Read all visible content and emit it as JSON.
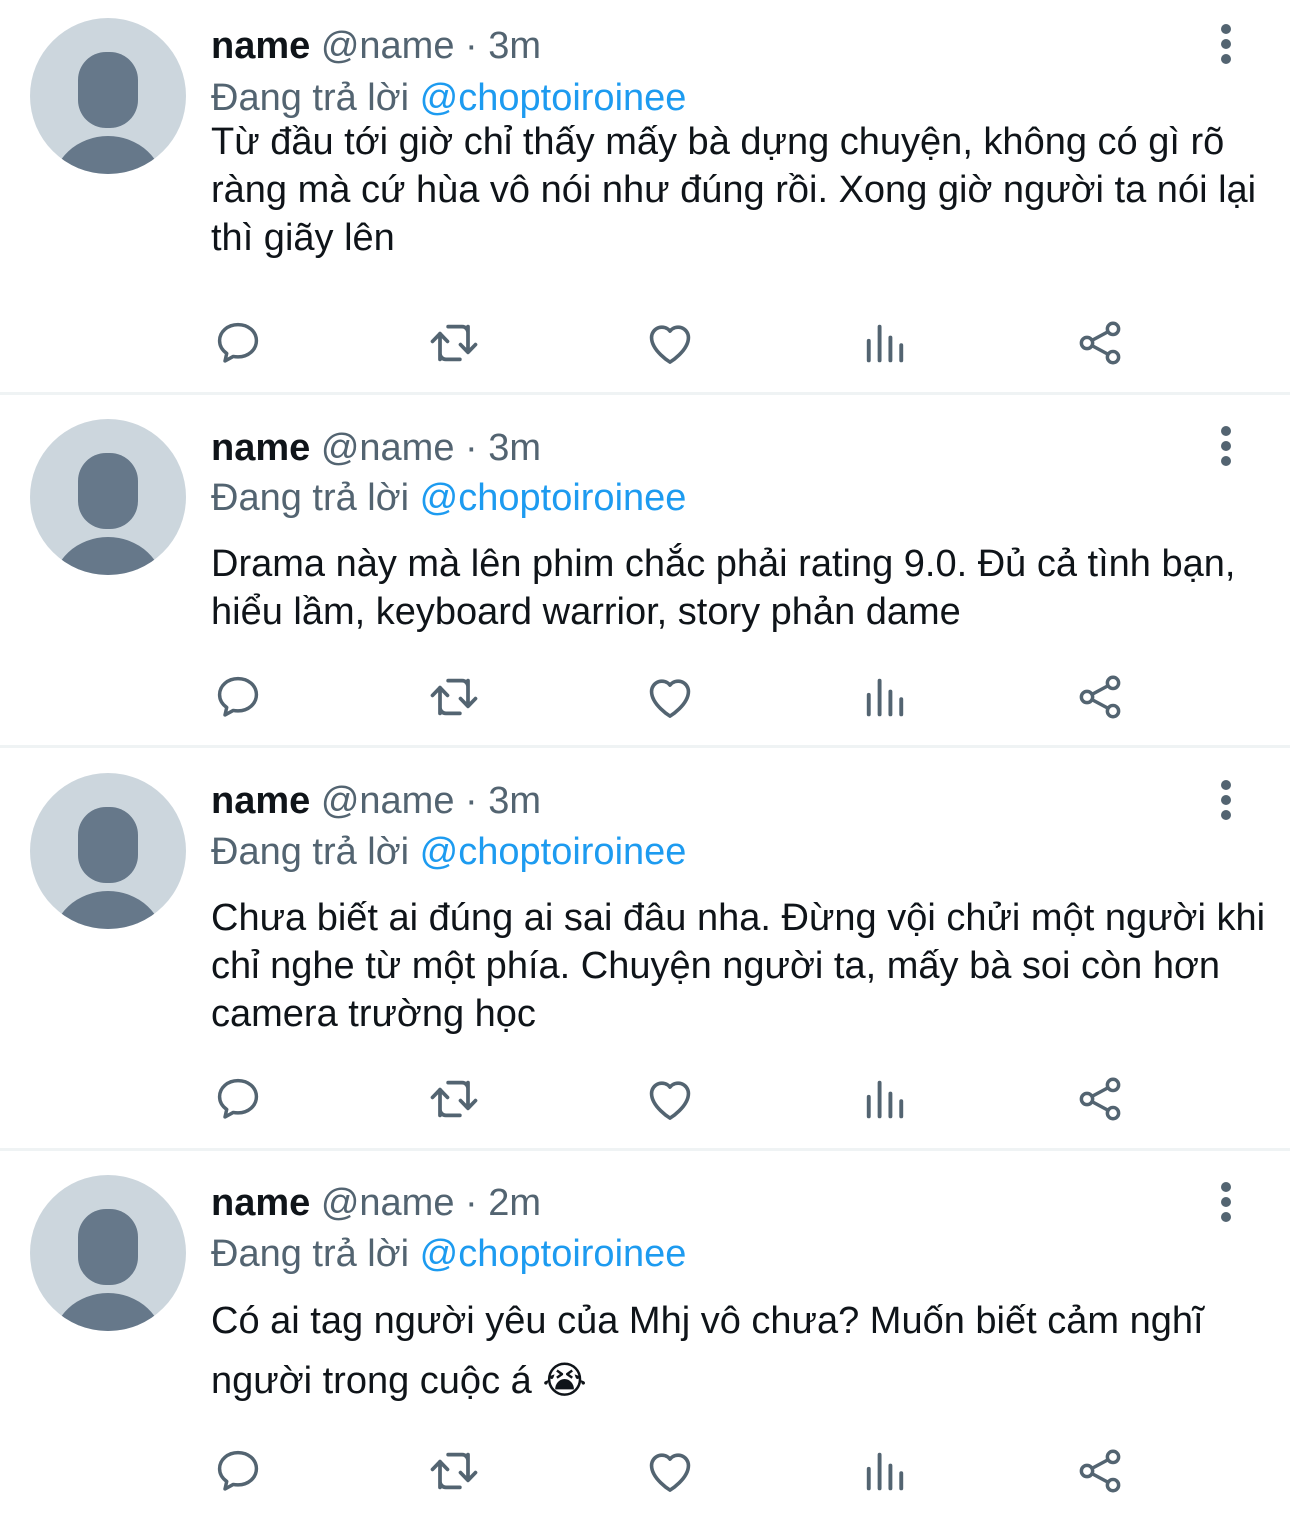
{
  "colors": {
    "text_primary": "#0f1419",
    "text_secondary": "#536471",
    "link": "#1d9bf0",
    "avatar_bg": "#ccd6dd",
    "avatar_fg": "#66788a",
    "divider": "#eff3f4"
  },
  "icons": {
    "reply": "speech-bubble-icon",
    "retweet": "retweet-icon",
    "like": "heart-icon",
    "views": "bar-chart-icon",
    "share": "share-icon",
    "menu": "vertical-ellipsis-icon"
  },
  "tweets": [
    {
      "name": "name",
      "handle": "@name",
      "separator": "·",
      "time": "3m",
      "reply_prefix": "Đang trả lời",
      "reply_to": "@choptoiroinee",
      "text": "Từ đầu tới giờ chỉ thấy mấy bà dựng chuyện, không có gì rõ ràng mà cứ hùa vô nói như đúng rồi. Xong giờ người ta nói lại thì giãy lên"
    },
    {
      "name": "name",
      "handle": "@name",
      "separator": "·",
      "time": "3m",
      "reply_prefix": "Đang trả lời",
      "reply_to": "@choptoiroinee",
      "text": "Drama này mà lên phim chắc phải rating 9.0. Đủ cả tình bạn, hiểu lầm, keyboard warrior, story phản dame"
    },
    {
      "name": "name",
      "handle": "@name",
      "separator": "·",
      "time": "3m",
      "reply_prefix": "Đang trả lời",
      "reply_to": "@choptoiroinee",
      "text": "Chưa biết ai đúng ai sai đâu nha. Đừng vội chửi một người khi chỉ nghe từ một phía. Chuyện người ta, mấy bà soi còn hơn camera trường học"
    },
    {
      "name": "name",
      "handle": "@name",
      "separator": "·",
      "time": "2m",
      "reply_prefix": "Đang trả lời",
      "reply_to": "@choptoiroinee",
      "text": "Có ai tag người yêu của Mhj vô chưa? Muốn biết cảm nghĩ người trong cuộc á 😭"
    }
  ]
}
